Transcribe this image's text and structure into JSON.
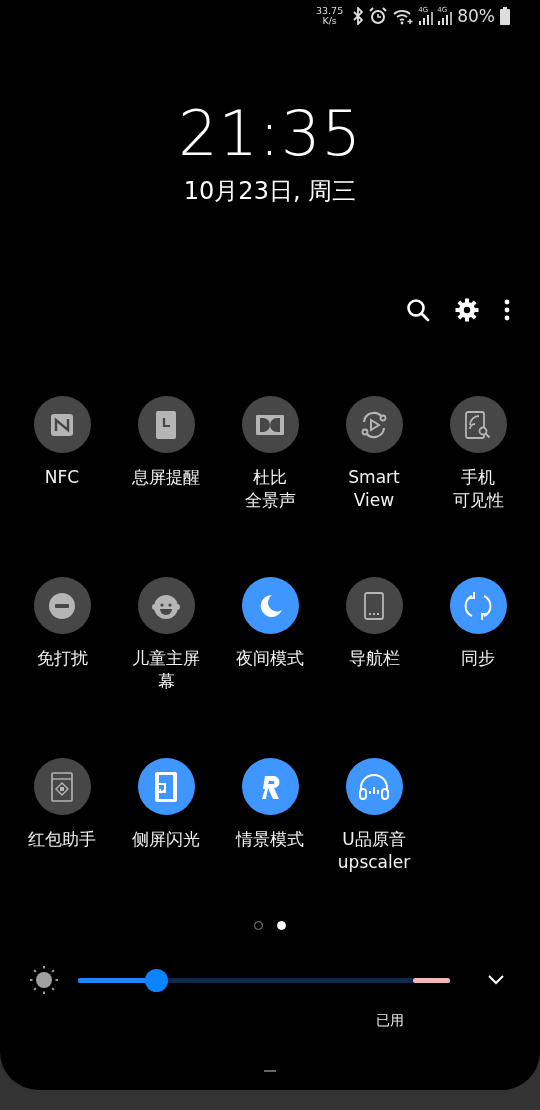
{
  "status_bar": {
    "speed": "33.75",
    "speed_unit": "K/s",
    "network_labels": [
      "4G",
      "4G"
    ],
    "battery": "80%"
  },
  "clock": {
    "time": "21:35",
    "date": "10月23日, 周三"
  },
  "tiles": [
    {
      "lines": [
        "NFC"
      ],
      "on": false
    },
    {
      "lines": [
        "息屏提醒"
      ],
      "on": false
    },
    {
      "lines": [
        "杜比",
        "全景声"
      ],
      "on": false
    },
    {
      "lines": [
        "Smart",
        "View"
      ],
      "on": false
    },
    {
      "lines": [
        "手机",
        "可见性"
      ],
      "on": false
    },
    {
      "lines": [
        "免打扰"
      ],
      "on": false
    },
    {
      "lines": [
        "儿童主屏幕"
      ],
      "on": false
    },
    {
      "lines": [
        "夜间模式"
      ],
      "on": true
    },
    {
      "lines": [
        "导航栏"
      ],
      "on": false
    },
    {
      "lines": [
        "同步"
      ],
      "on": true
    },
    {
      "lines": [
        "红包助手"
      ],
      "on": false
    },
    {
      "lines": [
        "侧屏闪光"
      ],
      "on": true
    },
    {
      "lines": [
        "情景模式"
      ],
      "on": true
    },
    {
      "lines": [
        "U品原音",
        "upscaler"
      ],
      "on": true
    }
  ],
  "pages": [
    {
      "selected": false
    },
    {
      "selected": true
    }
  ],
  "brightness": {
    "level": 0.21
  },
  "footer": {
    "usage": "已用"
  }
}
